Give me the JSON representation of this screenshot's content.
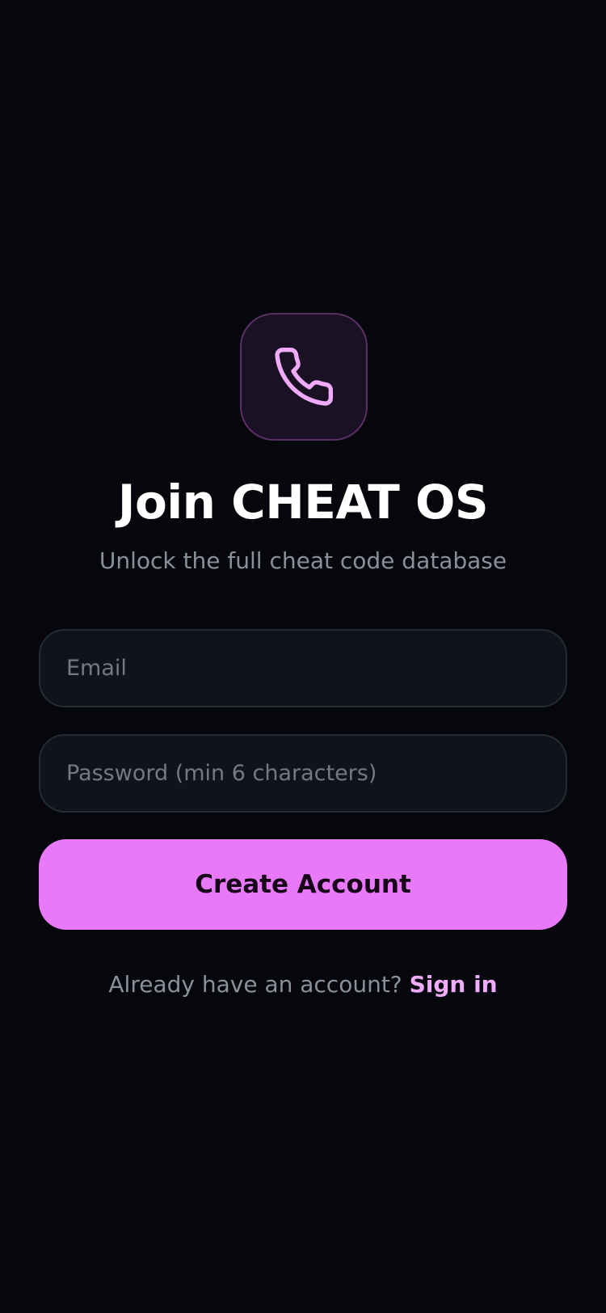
{
  "theme": {
    "background": "#05070d",
    "accent": "#e879f9",
    "accent_light": "#f0abfc",
    "field_background": "#10131b",
    "muted_text": "#8b8f99"
  },
  "header": {
    "icon": "phone-icon",
    "title": "Join CHEAT OS",
    "subtitle": "Unlock the full cheat code database"
  },
  "form": {
    "email": {
      "value": "",
      "placeholder": "Email"
    },
    "password": {
      "value": "",
      "placeholder": "Password (min 6 characters)"
    },
    "submit_label": "Create Account"
  },
  "footer": {
    "prompt": "Already have an account?",
    "link_label": "Sign in"
  }
}
